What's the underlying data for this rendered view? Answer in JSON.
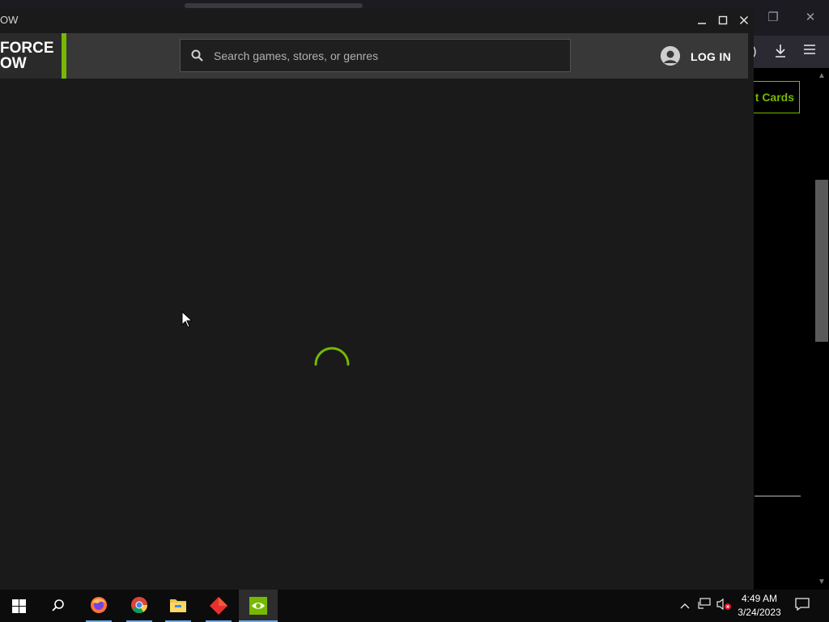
{
  "app": {
    "window_title": "OW",
    "logo_lines": [
      "FORCE",
      "OW"
    ],
    "search_placeholder": "Search games, stores, or genres",
    "login_label": "LOG IN"
  },
  "background_browser": {
    "button_label": "t Cards"
  },
  "taskbar": {
    "apps": [
      "start-button",
      "search-button",
      "firefox",
      "chrome",
      "file-explorer",
      "red-diamond-app",
      "geforce-now"
    ],
    "time": "4:49 AM",
    "date": "3/24/2023"
  },
  "colors": {
    "accent": "#76b900",
    "app_background": "#1a1a1a",
    "header_background": "#383838"
  }
}
